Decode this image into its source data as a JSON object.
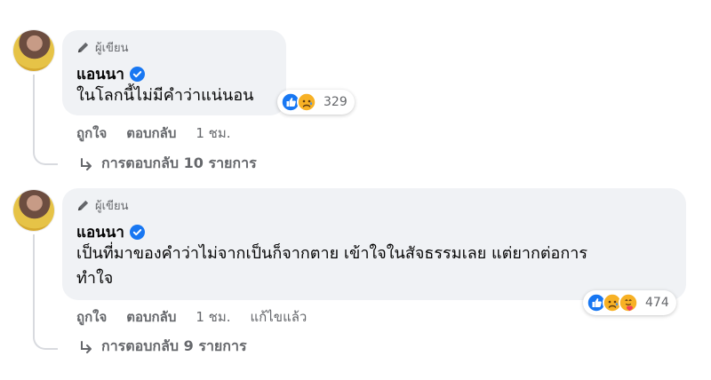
{
  "comments": [
    {
      "author_badge": "ผู้เขียน",
      "author": "แอนนา",
      "text": "ในโลกนี้ไม่มีคำว่าแน่นอน",
      "reaction_icons": [
        "like-icon",
        "sad-icon"
      ],
      "reaction_count": "329",
      "actions": {
        "like": "ถูกใจ",
        "reply": "ตอบกลับ",
        "time": "1 ชม.",
        "edited": ""
      },
      "replies_label": "การตอบกลับ 10 รายการ"
    },
    {
      "author_badge": "ผู้เขียน",
      "author": "แอนนา",
      "text_line1": "เป็นที่มาของคำว่าไม่จากเป็นก็จากตาย เข้าใจในสัจธรรมเลย แต่ยากต่อการ",
      "text_line2": "ทำใจ",
      "reaction_icons": [
        "like-icon",
        "sad-icon",
        "care-icon"
      ],
      "reaction_count": "474",
      "actions": {
        "like": "ถูกใจ",
        "reply": "ตอบกลับ",
        "time": "1 ชม.",
        "edited": "แก้ไขแล้ว"
      },
      "replies_label": "การตอบกลับ 9 รายการ"
    }
  ],
  "colors": {
    "bubble": "#f0f2f5",
    "verified": "#1877f2",
    "meta_text": "#65676b",
    "like": "#1877f2",
    "sad": "#f7b125"
  }
}
